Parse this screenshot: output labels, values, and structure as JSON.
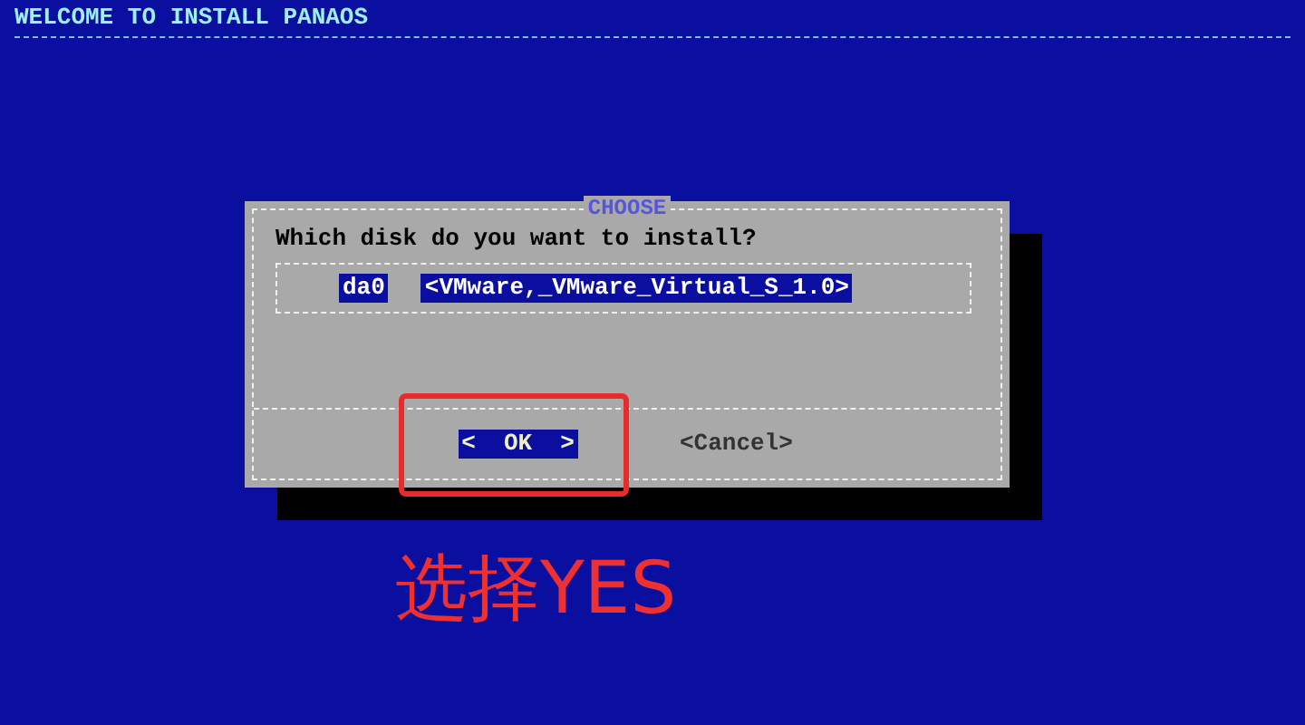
{
  "header": {
    "title": "WELCOME TO INSTALL PANAOS"
  },
  "dialog": {
    "title": "CHOOSE",
    "prompt": "Which disk do you want to install?",
    "items": [
      {
        "name": "da0",
        "description": "<VMware,_VMware_Virtual_S_1.0>",
        "selected": true
      }
    ],
    "buttons": [
      {
        "label": "<  OK  >",
        "selected": true,
        "highlighted": true
      },
      {
        "label": "<Cancel>",
        "selected": false,
        "highlighted": false
      }
    ]
  },
  "annotation": {
    "text": "选择YES"
  }
}
